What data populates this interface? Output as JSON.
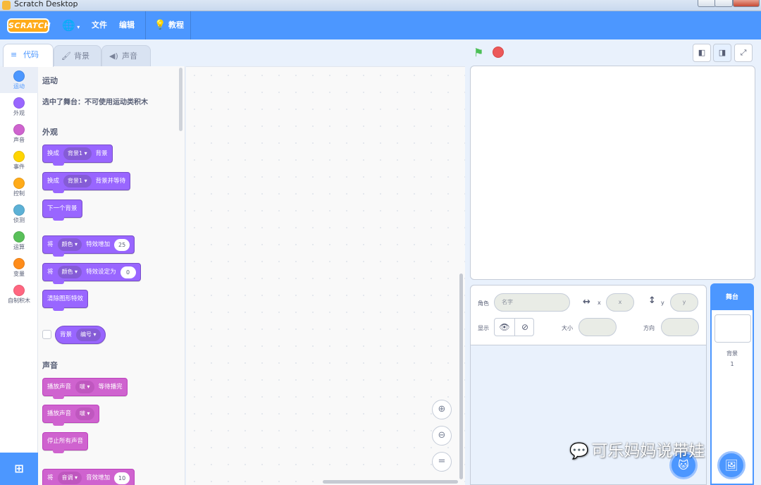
{
  "window": {
    "title": "Scratch Desktop"
  },
  "menubar": {
    "logo": "SCRATCH",
    "language_icon": "globe-icon",
    "file": "文件",
    "edit": "编辑",
    "tutorials": "教程"
  },
  "tabs": [
    {
      "label": "代码",
      "active": true
    },
    {
      "label": "背景",
      "active": false
    },
    {
      "label": "声音",
      "active": false
    }
  ],
  "categories": [
    {
      "label": "运动",
      "color": "#4c97ff"
    },
    {
      "label": "外观",
      "color": "#9966ff"
    },
    {
      "label": "声音",
      "color": "#cf63cf"
    },
    {
      "label": "事件",
      "color": "#ffd500"
    },
    {
      "label": "控制",
      "color": "#ffab19"
    },
    {
      "label": "侦测",
      "color": "#5cb1d6"
    },
    {
      "label": "运算",
      "color": "#59c059"
    },
    {
      "label": "变量",
      "color": "#ff8c1a"
    },
    {
      "label": "自制积木",
      "color": "#ff6680"
    }
  ],
  "palette": {
    "motion_title": "运动",
    "motion_notice": "选中了舞台：不可使用运动类积木",
    "looks_title": "外观",
    "looks_blocks": {
      "switch1": {
        "text": "换成",
        "dd": "背景1 ▾",
        "tail": "背景"
      },
      "switch2": {
        "text": "换成",
        "dd": "背景1 ▾",
        "tail": "背景并等待"
      },
      "next": {
        "text": "下一个背景"
      },
      "change_effect": {
        "text": "将",
        "dd": "颜色 ▾",
        "tail": "特效增加",
        "value": "25"
      },
      "set_effect": {
        "text": "将",
        "dd": "颜色 ▾",
        "tail": "特效设定为",
        "value": "0"
      },
      "clear": {
        "text": "清除图形特效"
      },
      "reporter": {
        "text": "背景",
        "dd": "编号 ▾"
      }
    },
    "sound_title": "声音",
    "sound_blocks": {
      "play_wait": {
        "text": "播放声音",
        "dd": "啵 ▾",
        "tail": "等待播完"
      },
      "play": {
        "text": "播放声音",
        "dd": "啵 ▾"
      },
      "stop_all": {
        "text": "停止所有声音"
      },
      "change_pitch": {
        "text": "将",
        "dd": "音调 ▾",
        "tail": "音效增加",
        "value": "10"
      }
    }
  },
  "sprite_info": {
    "sprite_label": "角色",
    "name_placeholder": "名字",
    "x_label": "x",
    "x_placeholder": "x",
    "y_label": "y",
    "y_placeholder": "y",
    "show_label": "显示",
    "size_label": "大小",
    "direction_label": "方向"
  },
  "stage_selector": {
    "title": "舞台",
    "backdrops_label": "背景",
    "backdrops_count": "1"
  },
  "watermark": "可乐妈妈说带娃"
}
